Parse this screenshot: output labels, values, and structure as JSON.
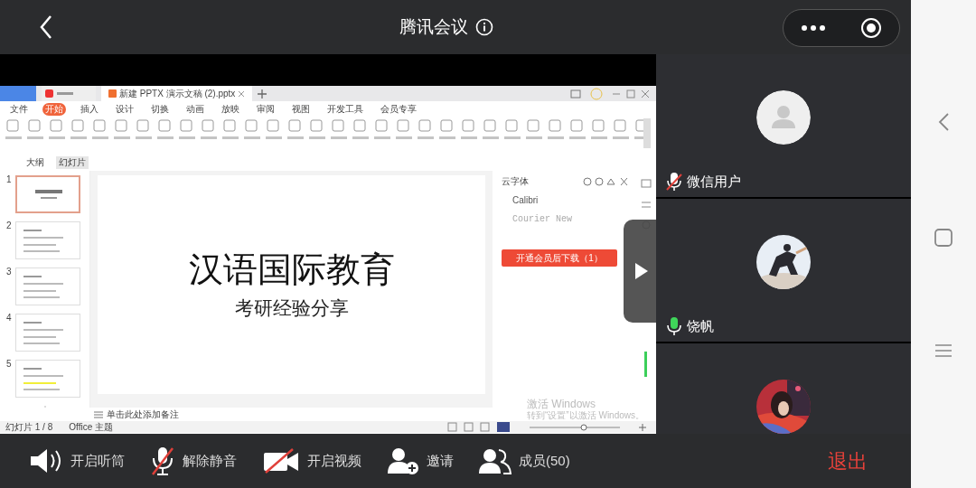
{
  "top_bar": {
    "title": "腾讯会议"
  },
  "shared_screen": {
    "document_tab": "新建 PPTX 演示文稿 (2).pptx",
    "ribbon_tabs": [
      {
        "label": "文件",
        "selected": false
      },
      {
        "label": "开始",
        "selected": true
      },
      {
        "label": "插入",
        "selected": false
      },
      {
        "label": "设计",
        "selected": false
      },
      {
        "label": "切换",
        "selected": false
      },
      {
        "label": "动画",
        "selected": false
      },
      {
        "label": "放映",
        "selected": false
      },
      {
        "label": "审阅",
        "selected": false
      },
      {
        "label": "视图",
        "selected": false
      },
      {
        "label": "开发工具",
        "selected": false
      },
      {
        "label": "会员专享",
        "selected": false
      }
    ],
    "view_tabs": [
      {
        "label": "大纲",
        "selected": false
      },
      {
        "label": "幻灯片",
        "selected": true
      }
    ],
    "slides": [
      {
        "number": "1",
        "selected": true
      },
      {
        "number": "2",
        "selected": false
      },
      {
        "number": "3",
        "selected": false
      },
      {
        "number": "4",
        "selected": false
      },
      {
        "number": "5",
        "selected": false
      }
    ],
    "slide": {
      "title": "汉语国际教育",
      "subtitle": "考研经验分享"
    },
    "font_panel": {
      "title": "云字体",
      "fonts": [
        "Calibri",
        "Courier New"
      ],
      "button": "开通会员后下载（1）"
    },
    "notes_placeholder": "单击此处添加备注",
    "status_bar": {
      "slide_count": "幻灯片 1 / 8",
      "theme": "Office 主题"
    },
    "activation_notice": {
      "title": "激活 Windows",
      "text": "转到“设置”以激活 Windows。"
    }
  },
  "participants": [
    {
      "name": "微信用户",
      "muted": true,
      "kind": "default-avatar"
    },
    {
      "name": "饶帆",
      "muted": false,
      "kind": "picture"
    },
    {
      "kind": "picture"
    }
  ],
  "toolbar": [
    {
      "label": "开启听筒",
      "kind": "speaker"
    },
    {
      "label": "解除静音",
      "kind": "mic-off"
    },
    {
      "label": "开启视频",
      "kind": "camera-off"
    },
    {
      "label": "邀请",
      "kind": "invite"
    },
    {
      "label": "成员(50)",
      "kind": "members"
    }
  ],
  "exit_button": "退出"
}
